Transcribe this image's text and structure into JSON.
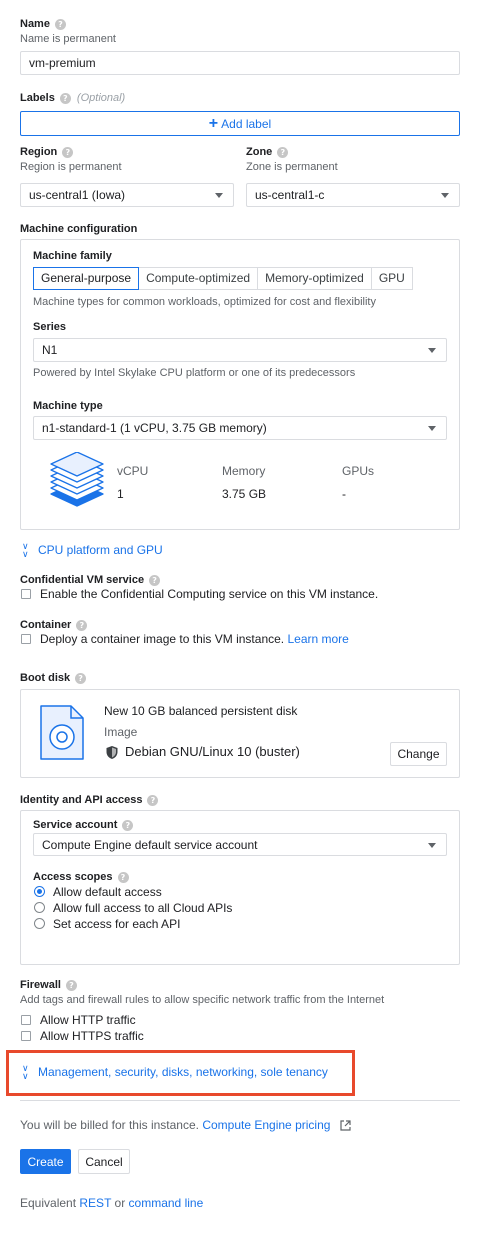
{
  "name": {
    "label": "Name",
    "hint": "Name is permanent",
    "value": "vm-premium"
  },
  "labels": {
    "label": "Labels",
    "optional": "(Optional)",
    "add_label": "Add label"
  },
  "region": {
    "label": "Region",
    "hint": "Region is permanent",
    "value": "us-central1 (Iowa)"
  },
  "zone": {
    "label": "Zone",
    "hint": "Zone is permanent",
    "value": "us-central1-c"
  },
  "machine": {
    "section_label": "Machine configuration",
    "family_label": "Machine family",
    "tabs": [
      "General-purpose",
      "Compute-optimized",
      "Memory-optimized",
      "GPU"
    ],
    "family_desc": "Machine types for common workloads, optimized for cost and flexibility",
    "series_label": "Series",
    "series_value": "N1",
    "series_desc": "Powered by Intel Skylake CPU platform or one of its predecessors",
    "type_label": "Machine type",
    "type_value": "n1-standard-1 (1 vCPU, 3.75 GB memory)",
    "specs": {
      "vcpu_label": "vCPU",
      "vcpu_value": "1",
      "memory_label": "Memory",
      "memory_value": "3.75 GB",
      "gpus_label": "GPUs",
      "gpus_value": "-"
    }
  },
  "cpu_platform": "CPU platform and GPU",
  "confidential": {
    "label": "Confidential VM service",
    "checkbox": "Enable the Confidential Computing service on this VM instance."
  },
  "container": {
    "label": "Container",
    "checkbox": "Deploy a container image to this VM instance.",
    "learn_more": "Learn more"
  },
  "boot_disk": {
    "label": "Boot disk",
    "title": "New 10 GB balanced persistent disk",
    "image_label": "Image",
    "image_value": "Debian GNU/Linux 10 (buster)",
    "change": "Change"
  },
  "identity": {
    "label": "Identity and API access",
    "sa_label": "Service account",
    "sa_value": "Compute Engine default service account",
    "scopes_label": "Access scopes",
    "scopes": [
      "Allow default access",
      "Allow full access to all Cloud APIs",
      "Set access for each API"
    ],
    "selected_scope": 0
  },
  "firewall": {
    "label": "Firewall",
    "desc": "Add tags and firewall rules to allow specific network traffic from the Internet",
    "http": "Allow HTTP traffic",
    "https": "Allow HTTPS traffic"
  },
  "management": "Management, security, disks, networking, sole tenancy",
  "billing": {
    "text": "You will be billed for this instance.",
    "link": "Compute Engine pricing"
  },
  "actions": {
    "create": "Create",
    "cancel": "Cancel"
  },
  "equivalent": {
    "prefix": "Equivalent",
    "rest": "REST",
    "or": "or",
    "cli": "command line"
  },
  "colors": {
    "accent": "#1a73e8",
    "primary_button": "#1a73e8",
    "highlight_border": "#e8492c"
  }
}
